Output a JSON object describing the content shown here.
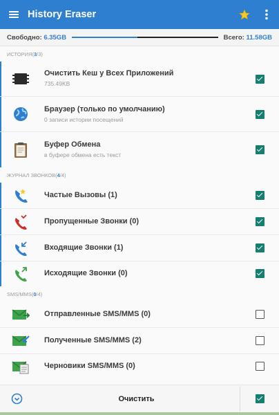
{
  "appbar": {
    "title": "History Eraser",
    "menu_icon": "menu-icon",
    "star_icon": "star-icon",
    "more_icon": "more-vert-icon",
    "accent": "#2f7fd1"
  },
  "storage": {
    "free_label": "Свободно:",
    "free_value": "6.35GB",
    "total_label": "Всего:",
    "total_value": "11.58GB",
    "used_fraction": 0.45
  },
  "sections": [
    {
      "label": "ИСТОРИЯ",
      "open": "(",
      "count": "3",
      "sep": "/",
      "total": "3",
      "close": ")"
    },
    {
      "label": "ЖУРНАЛ ЗВОНКОВ",
      "open": "(",
      "count": "4",
      "sep": "/",
      "total": "4",
      "close": ")"
    },
    {
      "label": "SMS/MMS",
      "open": "(",
      "count": "0",
      "sep": "/",
      "total": "4",
      "close": ")"
    }
  ],
  "items": [
    {
      "label": "Очистить Кеш у Всех Приложений",
      "sub": "735.49KB",
      "icon": "chip-icon",
      "checked": true
    },
    {
      "label": "Браузер (только по умолчанию)",
      "sub": "0 записи истории посещений",
      "icon": "globe-icon",
      "checked": true
    },
    {
      "label": "Буфер Обмена",
      "sub": "в буфере обмена есть текст",
      "icon": "clipboard-icon",
      "checked": true
    },
    {
      "label": "Частые Вызовы (1)",
      "icon": "phone-star-icon",
      "checked": true
    },
    {
      "label": "Пропущенные Звонки (0)",
      "icon": "phone-missed-icon",
      "checked": true
    },
    {
      "label": "Входящие Звонки (1)",
      "icon": "phone-incoming-icon",
      "checked": true
    },
    {
      "label": "Исходящие Звонки (0)",
      "icon": "phone-outgoing-icon",
      "checked": true
    },
    {
      "label": "Отправленные SMS/MMS (0)",
      "icon": "sms-sent-icon",
      "checked": false
    },
    {
      "label": "Полученные SMS/MMS (2)",
      "icon": "sms-received-icon",
      "checked": false
    },
    {
      "label": "Черновики SMS/MMS (0)",
      "icon": "sms-draft-icon",
      "checked": false
    }
  ],
  "footer": {
    "clean_label": "Очистить",
    "info_icon": "chevron-down-circle-icon",
    "select_all": true
  }
}
